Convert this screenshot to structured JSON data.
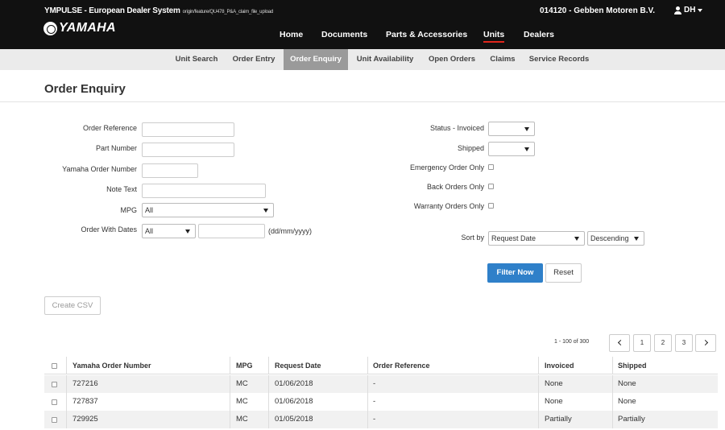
{
  "header": {
    "system_title": "YMPULSE - European Dealer System",
    "branch": "origin/feature/QU478_P&A_claim_file_upload",
    "logo_text": "YAMAHA",
    "dealer": "014120 - Gebben Motoren B.V.",
    "user_initials": "DH"
  },
  "main_nav": [
    "Home",
    "Documents",
    "Parts & Accessories",
    "Units",
    "Dealers"
  ],
  "main_nav_active": "Units",
  "sub_nav": [
    "Unit Search",
    "Order Entry",
    "Order Enquiry",
    "Unit Availability",
    "Open Orders",
    "Claims",
    "Service Records"
  ],
  "sub_nav_active": "Order Enquiry",
  "page_title": "Order Enquiry",
  "form": {
    "order_reference_label": "Order Reference",
    "part_number_label": "Part Number",
    "yamaha_order_number_label": "Yamaha Order Number",
    "note_text_label": "Note Text",
    "mpg_label": "MPG",
    "mpg_value": "All",
    "order_with_dates_label": "Order With Dates",
    "order_with_dates_value": "All",
    "date_format_hint": "(dd/mm/yyyy)",
    "status_invoiced_label": "Status - Invoiced",
    "shipped_label": "Shipped",
    "emergency_label": "Emergency Order Only",
    "back_orders_label": "Back Orders Only",
    "warranty_label": "Warranty Orders Only",
    "sort_by_label": "Sort by",
    "sort_by_value": "Request Date",
    "sort_dir_value": "Descending",
    "filter_button": "Filter Now",
    "reset_button": "Reset",
    "csv_button": "Create CSV"
  },
  "pagination": {
    "range": "1 - 100 of 300",
    "pages": [
      "1",
      "2",
      "3"
    ]
  },
  "table": {
    "columns": [
      "Yamaha Order Number",
      "MPG",
      "Request Date",
      "Order Reference",
      "Invoiced",
      "Shipped"
    ],
    "rows": [
      [
        "727216",
        "MC",
        "01/06/2018",
        "-",
        "None",
        "None"
      ],
      [
        "727837",
        "MC",
        "01/06/2018",
        "-",
        "None",
        "None"
      ],
      [
        "729925",
        "MC",
        "01/05/2018",
        "-",
        "Partially",
        "Partially"
      ]
    ]
  },
  "colors": {
    "topbar": "#111111",
    "accent_red": "#e0261c",
    "primary_blue": "#2f80c9",
    "subnav_bg": "#ebebeb",
    "subnav_active": "#9a9a9a"
  }
}
